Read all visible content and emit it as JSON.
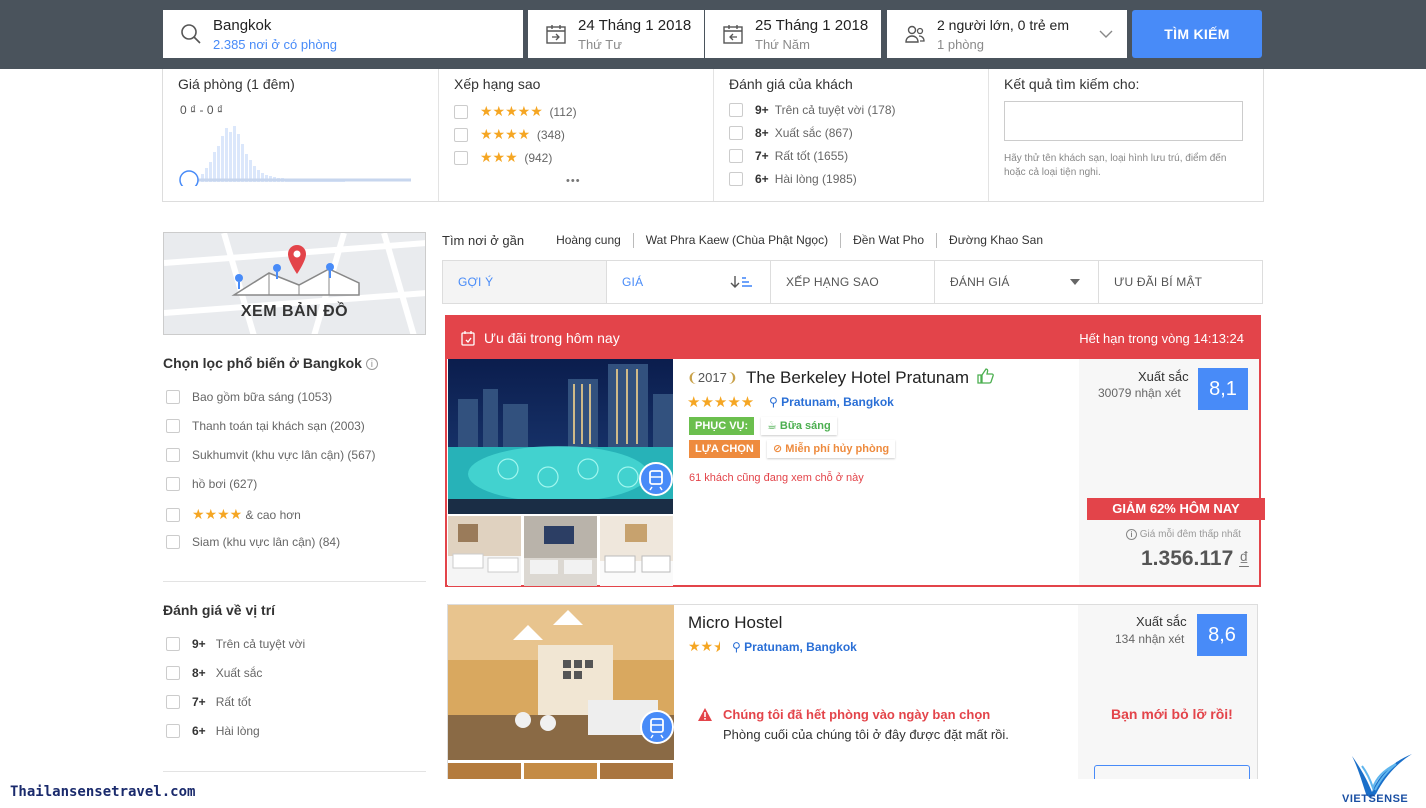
{
  "search": {
    "destination": "Bangkok",
    "destination_sub": "2.385 nơi ở có phòng",
    "checkin": "24 Tháng 1 2018",
    "checkin_day": "Thứ Tư",
    "checkout": "25 Tháng 1 2018",
    "checkout_day": "Thứ Năm",
    "guests": "2 người lớn, 0 trẻ em",
    "rooms": "1 phòng",
    "button": "TÌM KIẾM"
  },
  "filters": {
    "price": {
      "title": "Giá phòng (1 đêm)",
      "range": "0 ₫ - 0 ₫"
    },
    "stars": {
      "title": "Xếp hạng sao",
      "items": [
        {
          "stars": "★★★★★",
          "count": "(112)"
        },
        {
          "stars": "★★★★",
          "count": "(348)"
        },
        {
          "stars": "★★★",
          "count": "(942)"
        }
      ],
      "more": "•••"
    },
    "guest_rating": {
      "title": "Đánh giá của khách",
      "items": [
        {
          "score": "9+",
          "label": "Trên cả tuyệt vời (178)"
        },
        {
          "score": "8+",
          "label": "Xuất sắc (867)"
        },
        {
          "score": "7+",
          "label": "Rất tốt (1655)"
        },
        {
          "score": "6+",
          "label": "Hài lòng (1985)"
        }
      ]
    },
    "text_search": {
      "title": "Kết quả tìm kiếm cho:",
      "value": "",
      "hint": "Hãy thử tên khách sạn, loại hình lưu trú, điểm đến hoặc cả loại tiện nghi."
    }
  },
  "map": {
    "label": "XEM BẢN ĐỒ"
  },
  "popular": {
    "title": "Chọn lọc phổ biến ở Bangkok",
    "items": [
      {
        "label": "Bao gồm bữa sáng (1053)"
      },
      {
        "label": "Thanh toán tại khách sạn (2003)"
      },
      {
        "label": "Sukhumvit (khu vực lân cận) (567)"
      },
      {
        "label": "hồ bơi (627)"
      },
      {
        "stars": "★★★★",
        "label": "& cao hơn"
      },
      {
        "label": "Siam (khu vực lân cận) (84)"
      }
    ]
  },
  "location_rating": {
    "title": "Đánh giá về vị trí",
    "items": [
      {
        "score": "9+",
        "label": "Trên cả tuyệt vời"
      },
      {
        "score": "8+",
        "label": "Xuất sắc"
      },
      {
        "score": "7+",
        "label": "Rất tốt"
      },
      {
        "score": "6+",
        "label": "Hài lòng"
      }
    ]
  },
  "near": {
    "label": "Tìm nơi ở gần",
    "links": [
      "Hoàng cung",
      "Wat Phra Kaew (Chùa Phật Ngọc)",
      "Đền Wat Pho",
      "Đường Khao San"
    ]
  },
  "sort_tabs": [
    "GỢI Ý",
    "GIÁ",
    "XẾP HẠNG SAO",
    "ĐÁNH GIÁ",
    "ƯU ĐÃI BÍ MẬT"
  ],
  "deal": {
    "title": "Ưu đãi trong hôm nay",
    "expires": "Hết hạn trong vòng 14:13:24"
  },
  "hotel1": {
    "award_year": "2017",
    "name": "The Berkeley Hotel Pratunam",
    "stars": "★★★★★",
    "location": "Pratunam, Bangkok",
    "badge1": "PHỤC VỤ:",
    "badge1_note": "Bữa sáng",
    "badge2": "LỰA CHỌN",
    "badge2_note": "Miễn phí hủy phòng",
    "viewers": "61 khách cũng đang xem chỗ ở này",
    "review_word": "Xuất sắc",
    "review_count": "30079 nhận xét",
    "score": "8,1",
    "discount": "GIẢM 62% HÔM NAY",
    "price_note": "Giá mỗi đêm thấp nhất",
    "price": "1.356.117",
    "currency": "₫"
  },
  "hotel2": {
    "name": "Micro Hostel",
    "stars": "★★",
    "location": "Pratunam, Bangkok",
    "review_word": "Xuất sắc",
    "review_count": "134 nhận xét",
    "score": "8,6",
    "soldout_title": "Chúng tôi đã hết phòng vào ngày bạn chọn",
    "soldout_sub": "Phòng cuối của chúng tôi ở đây được đặt mất rồi.",
    "missed": "Bạn mới bỏ lỡ rồi!"
  },
  "watermark": "Thailansensetravel.com",
  "logo_text": "VIETSENSE",
  "colors": {
    "accent": "#488bf8",
    "deal": "#e3444a",
    "topbar": "#4a535c",
    "star": "#f5a623"
  }
}
